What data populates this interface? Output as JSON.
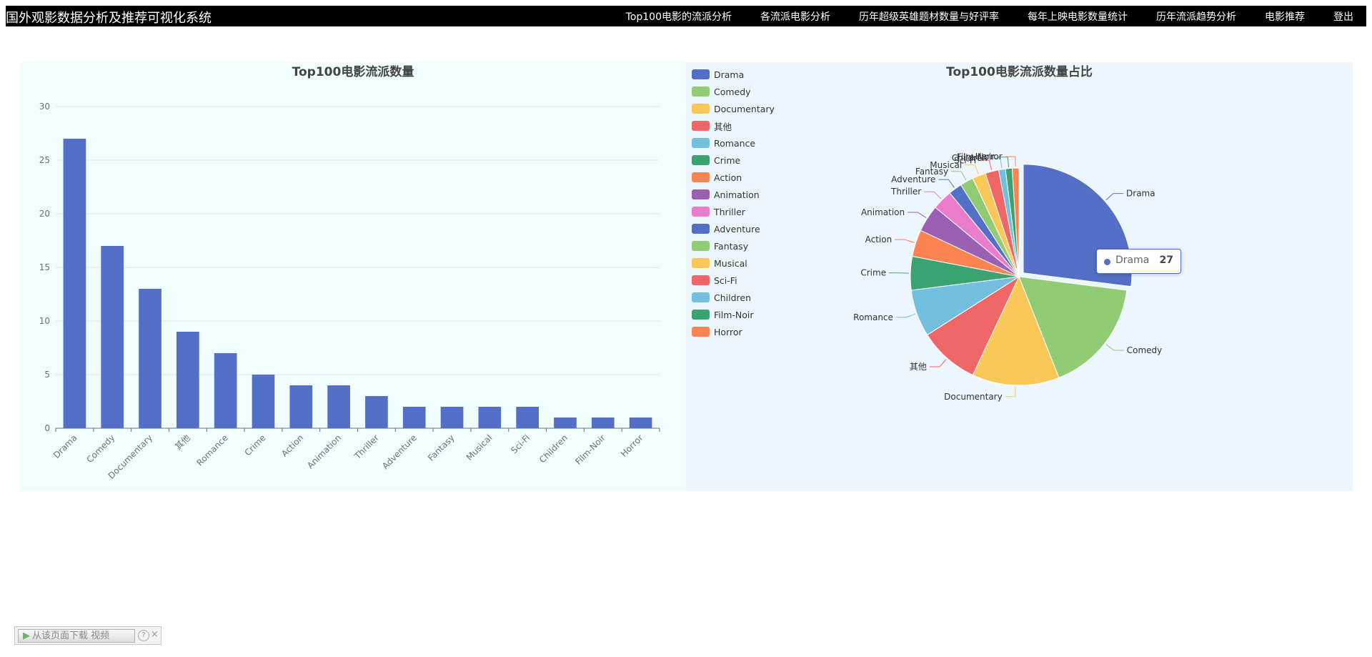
{
  "app": {
    "title": "国外观影数据分析及推荐可视化系统",
    "nav": [
      "Top100电影的流派分析",
      "各流派电影分析",
      "历年超级英雄题材数量与好评率",
      "每年上映电影数量统计",
      "历年流派趋势分析",
      "电影推荐",
      "登出"
    ]
  },
  "chart_data": [
    {
      "type": "bar",
      "title": "Top100电影流派数量",
      "categories": [
        "Drama",
        "Comedy",
        "Documentary",
        "其他",
        "Romance",
        "Crime",
        "Action",
        "Animation",
        "Thriller",
        "Adventure",
        "Fantasy",
        "Musical",
        "Sci-Fi",
        "Children",
        "Film-Noir",
        "Horror"
      ],
      "values": [
        27,
        17,
        13,
        9,
        7,
        5,
        4,
        4,
        3,
        2,
        2,
        2,
        2,
        1,
        1,
        1
      ],
      "ylim": [
        0,
        30
      ],
      "yticks": [
        0,
        5,
        10,
        15,
        20,
        25,
        30
      ],
      "grid": true,
      "color": "#5470c6"
    },
    {
      "type": "pie",
      "title": "Top100电影流派数量占比",
      "legend_position": "left",
      "labels": [
        "Drama",
        "Comedy",
        "Documentary",
        "其他",
        "Romance",
        "Crime",
        "Action",
        "Animation",
        "Thriller",
        "Adventure",
        "Fantasy",
        "Musical",
        "Sci-Fi",
        "Children",
        "Film-Noir",
        "Horror"
      ],
      "values": [
        27,
        17,
        13,
        9,
        7,
        5,
        4,
        4,
        3,
        2,
        2,
        2,
        2,
        1,
        1,
        1
      ],
      "colors": [
        "#5470c6",
        "#91cc75",
        "#fac858",
        "#ee6666",
        "#73c0de",
        "#3ba272",
        "#fc8452",
        "#9a60b4",
        "#ea7ccc",
        "#5470c6",
        "#91cc75",
        "#fac858",
        "#ee6666",
        "#73c0de",
        "#3ba272",
        "#fc8452"
      ],
      "highlighted": "Drama"
    }
  ],
  "tooltip": {
    "name": "Drama",
    "value": "27"
  },
  "download_bar": {
    "label": "从该页面下载 视频",
    "help": "?",
    "close": "×"
  }
}
